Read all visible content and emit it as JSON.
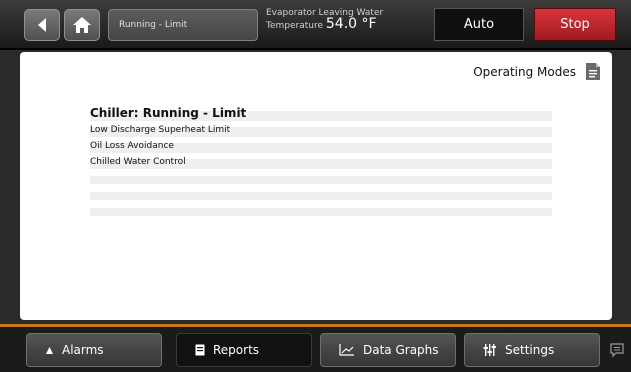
{
  "header": {
    "back_icon": "back-arrow-icon",
    "home_icon": "home-icon",
    "status_text": "Running - Limit",
    "evap_label_line1": "Evaporator Leaving Water",
    "evap_label_line2": "Temperature",
    "evap_value": "54.0 °F",
    "auto_label": "Auto",
    "stop_label": "Stop",
    "stop_color": "#c8262b"
  },
  "panel": {
    "title": "Operating Modes",
    "icon": "document-icon",
    "report_lines": [
      "Chiller:  Running - Limit",
      "Low Discharge Superheat Limit",
      "Oil Loss Avoidance",
      "Chilled Water Control"
    ]
  },
  "tabs": [
    {
      "label": "Alarms",
      "icon": "bell-icon"
    },
    {
      "label": "Reports",
      "icon": "report-icon"
    },
    {
      "label": "Data Graphs",
      "icon": "graph-icon"
    },
    {
      "label": "Settings",
      "icon": "sliders-icon"
    }
  ],
  "accent_color": "#c9781b",
  "chat_icon": "chat-icon"
}
